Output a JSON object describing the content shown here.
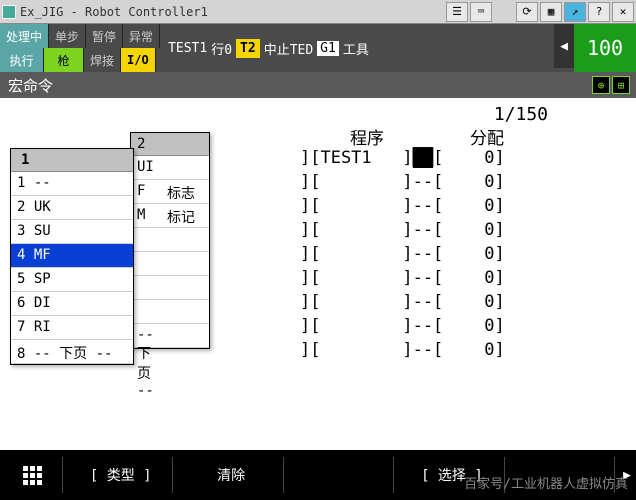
{
  "window": {
    "title": "Ex_JIG - Robot Controller1"
  },
  "status": {
    "row1": [
      "处理中",
      "单步",
      "暂停",
      "异常"
    ],
    "row2": [
      "执行",
      "枪",
      "焊接",
      "I/O"
    ],
    "program": "TEST1",
    "line_lbl": "行0",
    "t2": "T2",
    "halt": "中止TED",
    "g1": "G1",
    "tool": "工具",
    "speed": "100"
  },
  "section": "宏命令",
  "page": "1/150",
  "cols": {
    "prog": "程序",
    "alloc": "分配"
  },
  "rows": [
    {
      "prog": "TEST1",
      "a": "██",
      "b": "0"
    },
    {
      "prog": "",
      "a": "--",
      "b": "0"
    },
    {
      "prog": "",
      "a": "--",
      "b": "0"
    },
    {
      "prog": "",
      "a": "--",
      "b": "0"
    },
    {
      "prog": "",
      "a": "--",
      "b": "0"
    },
    {
      "prog": "",
      "a": "--",
      "b": "0"
    },
    {
      "prog": "",
      "a": "--",
      "b": "0"
    },
    {
      "prog": "",
      "a": "--",
      "b": "0"
    },
    {
      "prog": "",
      "a": "--",
      "b": "0"
    }
  ],
  "menu1": {
    "hdr": " 1",
    "items": [
      {
        "t": "1 --"
      },
      {
        "t": "2 UK"
      },
      {
        "t": "3 SU"
      },
      {
        "t": "4 MF",
        "sel": true
      },
      {
        "t": "5 SP"
      },
      {
        "t": "6 DI"
      },
      {
        "t": "7 RI"
      },
      {
        "t": "8 -- 下页 --"
      }
    ]
  },
  "menu2": {
    "hdr": " 2",
    "items": [
      {
        "a": "UI",
        "b": ""
      },
      {
        "a": "F",
        "b": "标志"
      },
      {
        "a": "M",
        "b": "标记"
      },
      {
        "a": "",
        "b": ""
      },
      {
        "a": "",
        "b": ""
      },
      {
        "a": "",
        "b": ""
      },
      {
        "a": "",
        "b": ""
      },
      {
        "a": "-- 下页 --",
        "b": ""
      }
    ]
  },
  "footer": {
    "b1": "[ 类型 ]",
    "b2": "清除",
    "b3": "",
    "b4": "[ 选择 ]",
    "b5": ""
  },
  "watermark": "百家号/工业机器人虚拟仿真"
}
